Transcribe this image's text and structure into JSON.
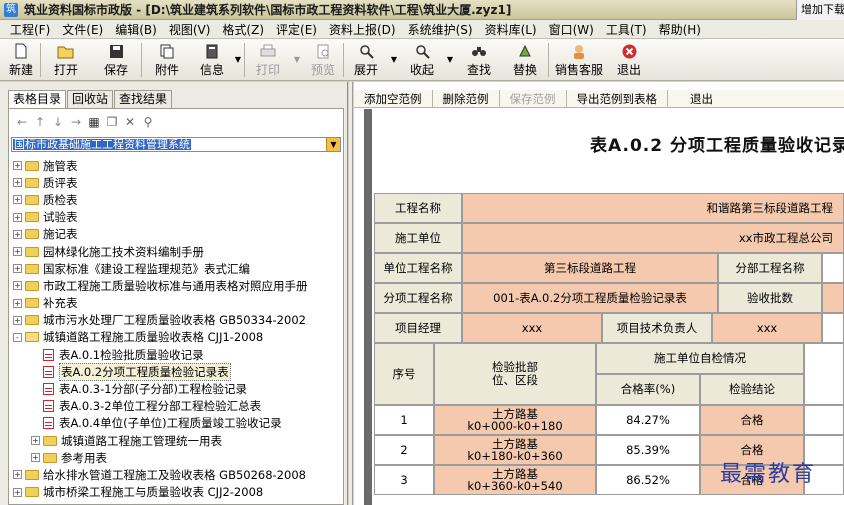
{
  "window": {
    "title": "筑业资料国标市政版 - [D:\\筑业建筑系列软件\\国标市政工程资料软件\\工程\\筑业大厦.zyz1]",
    "add_button": "增加下载"
  },
  "menu": [
    "工程(F)",
    "文件(E)",
    "编辑(B)",
    "视图(V)",
    "格式(Z)",
    "评定(E)",
    "资料上报(D)",
    "系统维护(S)",
    "资料库(L)",
    "窗口(W)",
    "工具(T)",
    "帮助(H)"
  ],
  "toolbar": {
    "new": "新建",
    "open": "打开",
    "save": "保存",
    "attach": "附件",
    "info": "信息",
    "print": "打印",
    "preview": "预览",
    "expand": "展开",
    "collapse": "收起",
    "find": "查找",
    "replace": "替换",
    "support": "销售客服",
    "exit": "退出"
  },
  "left": {
    "tabs": [
      "表格目录",
      "回收站",
      "查找结果"
    ],
    "nav_icons": [
      "back-arrow-icon",
      "up-arrow-icon",
      "down-arrow-icon",
      "forward-arrow-icon"
    ],
    "combo_value": "国标市政基础施工工程资料管理系统",
    "tree": [
      {
        "label": "施管表",
        "level": 0,
        "type": "folder",
        "exp": "+"
      },
      {
        "label": "质评表",
        "level": 0,
        "type": "folder",
        "exp": "+"
      },
      {
        "label": "质检表",
        "level": 0,
        "type": "folder",
        "exp": "+"
      },
      {
        "label": "试验表",
        "level": 0,
        "type": "folder",
        "exp": "+"
      },
      {
        "label": "施记表",
        "level": 0,
        "type": "folder",
        "exp": "+"
      },
      {
        "label": "园林绿化施工技术资料编制手册",
        "level": 0,
        "type": "folder",
        "exp": "+"
      },
      {
        "label": "国家标准《建设工程监理规范》表式汇编",
        "level": 0,
        "type": "folder",
        "exp": "+"
      },
      {
        "label": "市政工程施工质量验收标准与通用表格对照应用手册",
        "level": 0,
        "type": "folder",
        "exp": "+"
      },
      {
        "label": "补充表",
        "level": 0,
        "type": "folder",
        "exp": "+"
      },
      {
        "label": "城市污水处理厂工程质量验收表格 GB50334-2002",
        "level": 0,
        "type": "folder",
        "exp": "+"
      },
      {
        "label": "城镇道路工程施工质量验收表格 CJJ1-2008",
        "level": 0,
        "type": "folder-open",
        "exp": "-"
      },
      {
        "label": "表A.0.1检验批质量验收记录",
        "level": 1,
        "type": "doc"
      },
      {
        "label": "表A.0.2分项工程质量检验记录表",
        "level": 1,
        "type": "doc",
        "selected": true
      },
      {
        "label": "表A.0.3-1分部(子分部)工程检验记录",
        "level": 1,
        "type": "doc"
      },
      {
        "label": "表A.0.3-2单位工程分部工程检验汇总表",
        "level": 1,
        "type": "doc"
      },
      {
        "label": "表A.0.4单位(子单位)工程质量竣工验收记录",
        "level": 1,
        "type": "doc"
      },
      {
        "label": "城镇道路工程施工管理统一用表",
        "level": 1,
        "type": "folder",
        "exp": "+"
      },
      {
        "label": "参考用表",
        "level": 1,
        "type": "folder",
        "exp": "+"
      },
      {
        "label": "给水排水管道工程施工及验收表格 GB50268-2008",
        "level": 0,
        "type": "folder",
        "exp": "+"
      },
      {
        "label": "城市桥梁工程施工与质量验收表 CJJ2-2008",
        "level": 0,
        "type": "folder",
        "exp": "+"
      }
    ]
  },
  "right_toolbar": [
    "添加空范例",
    "删除范例",
    "保存范例",
    "导出范例到表格",
    "退出"
  ],
  "form": {
    "title": "表A.0.2 分项工程质量验收记录",
    "project_name_label": "工程名称",
    "project_name": "和谐路第三标段道路工程",
    "construction_unit_label": "施工单位",
    "construction_unit": "xx市政工程总公司",
    "unit_project_label": "单位工程名称",
    "unit_project": "第三标段道路工程",
    "division_label": "分部工程名称",
    "subitem_label": "分项工程名称",
    "subitem": "001-表A.0.2分项工程质量检验记录表",
    "batch_count_label": "验收批数",
    "pm_label": "项目经理",
    "pm": "xxx",
    "tech_lead_label": "项目技术负责人",
    "tech_lead": "xxx",
    "col_seq": "序号",
    "col_batch": "检验批部\n位、区段",
    "col_self_check": "施工单位自检情况",
    "col_rate": "合格率(%)",
    "col_result": "检验结论",
    "rows": [
      {
        "seq": "1",
        "batch": "土方路基\nk0+000-k0+180",
        "rate": "84.27%",
        "result": "合格"
      },
      {
        "seq": "2",
        "batch": "土方路基\nk0+180-k0+360",
        "rate": "85.39%",
        "result": "合格"
      },
      {
        "seq": "3",
        "batch": "土方路基\nk0+360-k0+540",
        "rate": "86.52%",
        "result": "合格"
      }
    ]
  },
  "watermark": "最需教育"
}
